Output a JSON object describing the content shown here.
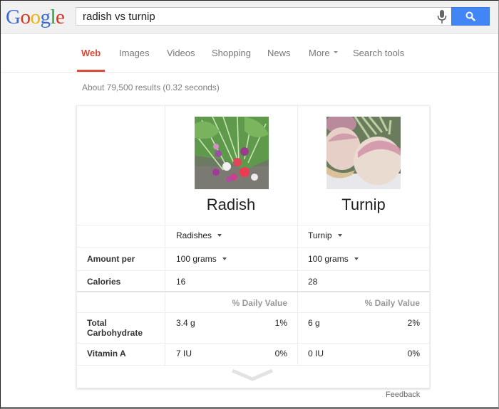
{
  "header": {
    "logo": [
      "G",
      "o",
      "o",
      "g",
      "l",
      "e"
    ],
    "search_query": "radish vs turnip",
    "mic_icon": "microphone-icon",
    "search_button_icon": "search-icon"
  },
  "tabs": [
    {
      "label": "Web",
      "active": true
    },
    {
      "label": "Images",
      "active": false
    },
    {
      "label": "Videos",
      "active": false
    },
    {
      "label": "Shopping",
      "active": false
    },
    {
      "label": "News",
      "active": false
    },
    {
      "label": "More",
      "active": false
    },
    {
      "label": "Search tools",
      "active": false
    }
  ],
  "stats": "About 79,500 results (0.32 seconds)",
  "comparison": {
    "foods": [
      {
        "name": "Radish",
        "variety": "Radishes",
        "amount": "100 grams",
        "calories": "16",
        "carb": "3.4 g",
        "carb_pct": "1%",
        "vitA": "7 IU",
        "vitA_pct": "0%"
      },
      {
        "name": "Turnip",
        "variety": "Turnip",
        "amount": "100 grams",
        "calories": "28",
        "carb": "6 g",
        "carb_pct": "2%",
        "vitA": "0 IU",
        "vitA_pct": "0%"
      }
    ],
    "row_labels": {
      "amount_per": "Amount per",
      "calories": "Calories",
      "total_carb_1": "Total",
      "total_carb_2": "Carbohydrate",
      "vitamin_a": "Vitamin A"
    },
    "daily_value_header": "% Daily Value",
    "expand_icon": "chevron-down-icon"
  },
  "feedback": "Feedback",
  "colors": {
    "accent_red": "#dd4b39",
    "search_blue": "#4285f4"
  }
}
